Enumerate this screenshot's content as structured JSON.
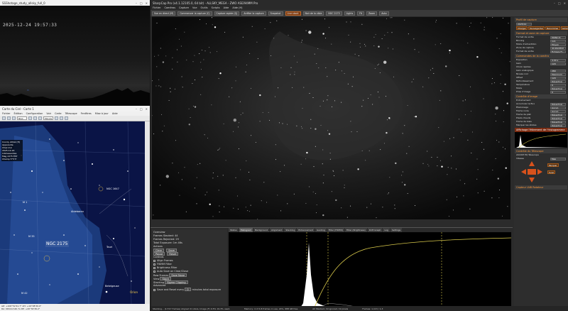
{
  "camera_window": {
    "title": "SSShotage_study_allsky_full_0",
    "timestamp": "2025-12-24 19:57:33"
  },
  "stellarium": {
    "title": "Carte du Ciel - Carte 1",
    "menu": [
      "Fichier",
      "Édition",
      "Configuration",
      "Voir",
      "Carte",
      "Télescope",
      "Fenêtres",
      "Mise à jour",
      "Aide"
    ],
    "field_value": "NGC",
    "unit_value": "Minute",
    "info_lines": [
      "Coord. Alt/Az (H)",
      "Apparente",
      "Chez moi",
      "2025-12-24",
      "Intéressantes",
      "Mag 2275 EST",
      "Champ 5°5'3'"
    ],
    "labels": {
      "ngc1647": "NGC 1647",
      "ngc2175": "NGC 2175",
      "m1": "M 1",
      "m35": "M 35",
      "betelgeuse": "Betelgeuse",
      "orion": "Orion",
      "tauri": "Tauri",
      "aldebaran": "Aldebaran",
      "m42": "M 42"
    },
    "scale_label": "Orion",
    "status_lines": [
      "AZ: +100°52'41.7\" AH: +19°08'30.0\"",
      "RA: 06h11m40.7s  DE: +20°30'36.2\""
    ]
  },
  "sharpcap": {
    "title": "SharpCap Pro (v4.1.12105.0, 64 bit) - ALLSKY_MEGA - ZWO ASI294MM Pro",
    "menu": [
      "Fichier",
      "Caméras",
      "Capture",
      "Vue",
      "Outils",
      "Scripts",
      "Aide",
      "Aide (H)"
    ],
    "toolbar": [
      {
        "label": "Vue en direct (M)",
        "hot": false
      },
      {
        "label": "Commencer la capture (C)",
        "hot": false
      },
      {
        "label": "Capture rapide (Q)",
        "hot": false
      },
      {
        "label": "Arrêter la capture",
        "hot": false
      },
      {
        "label": "Snapshot",
        "hot": false
      },
      {
        "label": "Live stack",
        "hot": true
      },
      {
        "label": "Noir de la cible",
        "hot": false
      },
      {
        "label": "NGC 2175",
        "hot": false
      },
      {
        "label": "Lights",
        "hot": false
      },
      {
        "label": "Fit",
        "hot": false
      },
      {
        "label": "Zoom",
        "hot": false
      },
      {
        "label": "Auto",
        "hot": false
      }
    ],
    "live_stack": {
      "tabs": [
        "Status",
        "Histogram",
        "Background",
        "Alignment",
        "Stacking",
        "Enhancement",
        "Guiding",
        "Filter (FWHM)",
        "Filter (Brightness)",
        "Drift Graph",
        "Log",
        "Settings"
      ],
      "selected_tab": "Histogram",
      "overview": "Overview",
      "frames_stacked_label": "Frames Stacked",
      "frames_stacked": "44",
      "frames_rejected_label": "Frames Rejected",
      "frames_rejected": "29",
      "total_exposure_label": "Total Exposure",
      "total_exposure": "1m 46s",
      "actions_label": "Actions",
      "clear_label": "Clear",
      "save_label": "Save",
      "pause_label": "Pause",
      "reset_label": "Reset",
      "controls_label": "Controls",
      "align_frames_label": "Align Frames",
      "fwhm_filter_label": "FWHM Filter",
      "brightness_filter_label": "Brightness Filter",
      "auto_save_label": "Auto Save on Clear/Close",
      "raw_frames_label": "Raw Frames",
      "raw_frames_value": "Save None",
      "view_label": "View",
      "view_value": "Stack",
      "stacking_label": "Stacking",
      "stacking_value": "Sigma Clipping",
      "advanced_label": "Advanced",
      "save_reset_label": "Save and Reset every",
      "save_reset_value": "0",
      "minutes_label": "minutes total exposure"
    },
    "status_bar": [
      "Stacking... (17/17 frames) Aligned 21 stars, Image (F) 0.5% 19.3% used.",
      "Memory: 4 of 4.8 frames in use, 24%, 688 GB free.",
      "All Stacked, 19 ignored, 19 pixels",
      "Frames: 1,113 / 1,3"
    ],
    "right_panel": {
      "capture_profile": "Profil de capture",
      "profile_value": "2025/12",
      "profile_buttons": [
        "Charger",
        "Sauvegarder",
        "Renommer",
        "Gérer"
      ],
      "format_section": "Format et zone de capture",
      "format_rows": [
        {
          "label": "Format de sortie",
          "value": "MONO 8"
        },
        {
          "label": "Binning",
          "value": "1x1"
        },
        {
          "label": "Mode d'échantillon",
          "value": "Moyen"
        },
        {
          "label": "Zone de capture",
          "value": "4144x2822"
        },
        {
          "label": "Format de sortie",
          "value": "Fichiers FI..."
        }
      ],
      "camera_section": "Commandes de la caméra",
      "camera_rows": [
        {
          "label": "Exposition",
          "value": "4.00 s"
        },
        {
          "label": "Gain",
          "value": "120"
        },
        {
          "label": "Choix rapides",
          "value": ""
        },
        {
          "label": "Gain analogique",
          "value": "280"
        },
        {
          "label": "Niveau noir",
          "value": "Maximum"
        },
        {
          "label": "Offset",
          "value": "120"
        },
        {
          "label": "Refroidissement",
          "value": "Désactivé"
        },
        {
          "label": "Température",
          "value": "0"
        },
        {
          "label": "Mode",
          "value": "Désactivé"
        },
        {
          "label": "Prise d'image",
          "value": "0"
        }
      ],
      "image_section": "Contrôle d'image",
      "image_rows": [
        {
          "label": "Entraînement",
          "value": ""
        },
        {
          "label": "Accumuler le flux",
          "value": "Désactivé"
        },
        {
          "label": "Étalonnage",
          "value": "Aucun"
        },
        {
          "label": "Trame noire",
          "value": "Aucun"
        },
        {
          "label": "Trame de plat",
          "value": "Désactivé"
        },
        {
          "label": "Pixels chauds",
          "value": "Désactivé"
        },
        {
          "label": "Trame de biais",
          "value": "Désactivé"
        },
        {
          "label": "Marquer les étoiles",
          "value": "Désactivé"
        }
      ],
      "histogram_section": "Affichage l'étirement de l'histogramme",
      "telescope_section": "Contrôle du Télescope",
      "telescope_rows": [
        {
          "label": "ASCOM EQ Télescope",
          "value": ""
        },
        {
          "label": "Vitesse",
          "value": "Max"
        }
      ],
      "park_label": "Parquer",
      "tracking_label": "Suivi",
      "last_section": "Capteur LNB Rotateur"
    }
  },
  "colors": {
    "accent": "#c46a2a",
    "highlight": "#ff9a3a",
    "sky_blue": "#0a1446",
    "nebula": "#1e4f9c"
  }
}
